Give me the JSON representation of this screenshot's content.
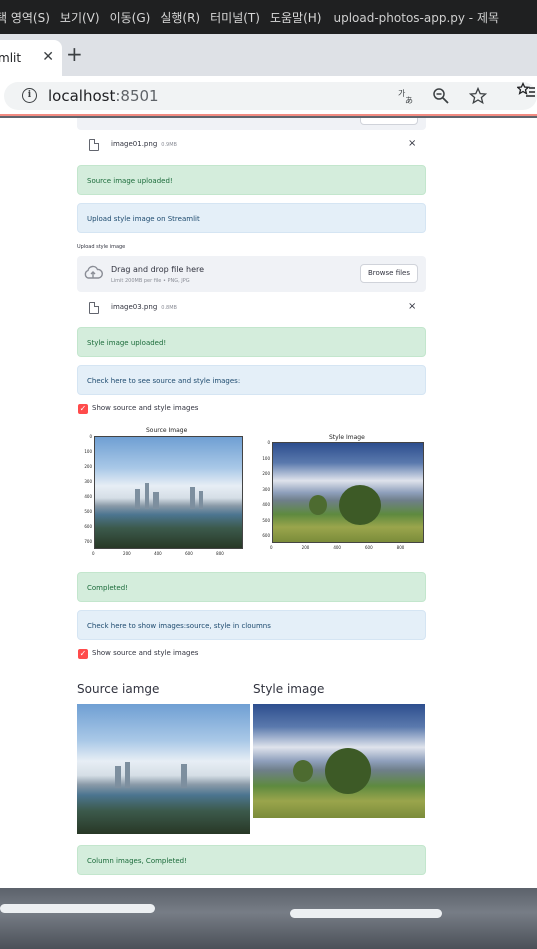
{
  "menubar": {
    "items": [
      "택 영역(S)",
      "보기(V)",
      "이동(G)",
      "실행(R)",
      "터미널(T)",
      "도움말(H)"
    ],
    "title": "upload-photos-app.py - 제목"
  },
  "browser": {
    "tab_label": "mlit",
    "url_host": "localhost",
    "url_port": ":8501",
    "icons": [
      "info-icon",
      "translate-icon",
      "zoom-out-icon",
      "star-icon",
      "favorites-icon"
    ]
  },
  "source_file": {
    "name": "image01.png",
    "size": "0.9MB"
  },
  "msg_source_uploaded": "Source image uploaded!",
  "msg_upload_style": "Upload style image on Streamlit",
  "style_uploader": {
    "label": "Upload style image",
    "drag_text": "Drag and drop file here",
    "limit_text": "Limit 200MB per file • PNG, JPG",
    "browse_label": "Browse files",
    "file_name": "image03.png",
    "file_size": "0.8MB"
  },
  "msg_style_uploaded": "Style image uploaded!",
  "msg_check_here": "Check here to see source and style images:",
  "checkbox_1": {
    "label": "Show source and style images",
    "checked": true
  },
  "figures": {
    "source": {
      "title": "Source Image",
      "yticks": [
        "0",
        "100",
        "200",
        "300",
        "400",
        "500",
        "600",
        "700"
      ],
      "xticks": [
        "0",
        "200",
        "400",
        "600",
        "800"
      ]
    },
    "style": {
      "title": "Style Image",
      "yticks": [
        "0",
        "100",
        "200",
        "300",
        "400",
        "500",
        "600"
      ],
      "xticks": [
        "0",
        "200",
        "400",
        "600",
        "800"
      ]
    }
  },
  "msg_completed": "Completed!",
  "msg_columns_check": "Check here to show images:source, style in cloumns",
  "checkbox_2": {
    "label": "Show source and style images",
    "checked": true
  },
  "columns": {
    "source_header": "Source iamge",
    "style_header": "Style image"
  },
  "msg_column_completed": "Column images, Completed!",
  "colors": {
    "success_bg": "#d4eddc",
    "info_bg": "#e4eff8",
    "checkbox": "#ff4b4b"
  }
}
